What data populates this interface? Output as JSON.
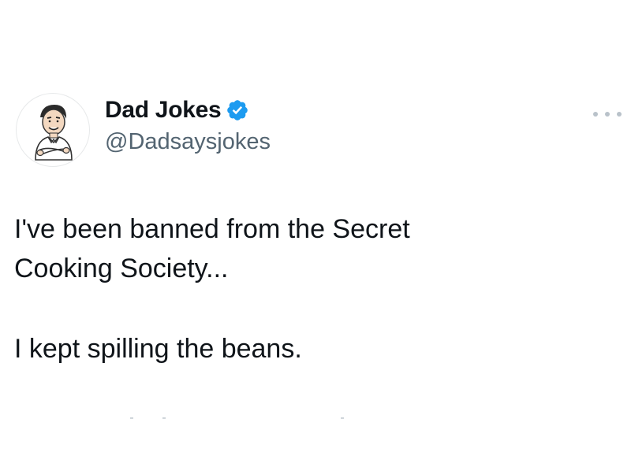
{
  "tweet": {
    "author": {
      "display_name": "Dad Jokes",
      "handle": "@Dadsaysjokes",
      "verified": true,
      "avatar_icon": "cartoon-man-avatar",
      "verified_icon": "verified-badge-icon"
    },
    "text_lines": [
      "I've been banned from the Secret",
      "Cooking Society...",
      "I kept spilling the beans."
    ],
    "more_icon": "more-options-icon"
  },
  "colors": {
    "text": "#0f1419",
    "secondary_text": "#536471",
    "verified_blue": "#1d9bf0",
    "background": "#ffffff"
  }
}
